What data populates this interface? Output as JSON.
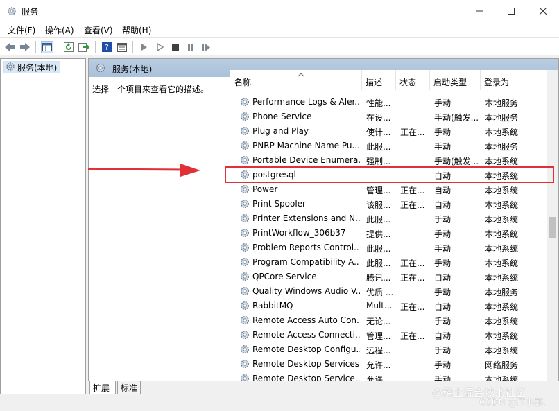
{
  "window": {
    "title": "服务"
  },
  "menu": [
    "文件(F)",
    "操作(A)",
    "查看(V)",
    "帮助(H)"
  ],
  "tree": {
    "item": "服务(本地)"
  },
  "panel": {
    "title": "服务(本地)",
    "description": "选择一个项目来查看它的描述。"
  },
  "columns": [
    "名称",
    "描述",
    "状态",
    "启动类型",
    "登录为"
  ],
  "services": [
    [
      "Performance Logs & Aler...",
      "性能...",
      "",
      "手动",
      "本地服务"
    ],
    [
      "Phone Service",
      "在设...",
      "",
      "手动(触发...",
      "本地服务"
    ],
    [
      "Plug and Play",
      "使计...",
      "正在...",
      "手动",
      "本地系统"
    ],
    [
      "PNRP Machine Name Pu...",
      "此服...",
      "",
      "手动",
      "本地服务"
    ],
    [
      "Portable Device Enumera...",
      "强制...",
      "",
      "手动(触发...",
      "本地系统"
    ],
    [
      "postgresql",
      "",
      "",
      "自动",
      "本地系统"
    ],
    [
      "Power",
      "管理...",
      "正在...",
      "自动",
      "本地系统"
    ],
    [
      "Print Spooler",
      "该服...",
      "正在...",
      "自动",
      "本地系统"
    ],
    [
      "Printer Extensions and N...",
      "此服...",
      "",
      "手动",
      "本地系统"
    ],
    [
      "PrintWorkflow_306b37",
      "提供...",
      "",
      "手动",
      "本地系统"
    ],
    [
      "Problem Reports Control...",
      "此服...",
      "",
      "手动",
      "本地系统"
    ],
    [
      "Program Compatibility A...",
      "此服...",
      "正在...",
      "手动",
      "本地系统"
    ],
    [
      "QPCore Service",
      "腾讯...",
      "正在...",
      "自动",
      "本地系统"
    ],
    [
      "Quality Windows Audio V...",
      "优质 ...",
      "",
      "手动",
      "本地服务"
    ],
    [
      "RabbitMQ",
      "Mult...",
      "正在...",
      "自动",
      "本地系统"
    ],
    [
      "Remote Access Auto Con...",
      "无论...",
      "",
      "手动",
      "本地系统"
    ],
    [
      "Remote Access Connecti...",
      "管理...",
      "正在...",
      "自动",
      "本地系统"
    ],
    [
      "Remote Desktop Configu...",
      "远程...",
      "",
      "手动",
      "本地系统"
    ],
    [
      "Remote Desktop Services",
      "允许...",
      "",
      "手动",
      "网络服务"
    ],
    [
      "Remote Desktop Service...",
      "允许...",
      "",
      "手动",
      "本地系统"
    ]
  ],
  "tabs": [
    "扩展",
    "标准"
  ],
  "watermark": {
    "line1": "@稀土掘金技术社区",
    "line2": "CSDN @IT小郭."
  },
  "colors": {
    "highlight": "#e03138",
    "header_band": "#b9cde1"
  }
}
